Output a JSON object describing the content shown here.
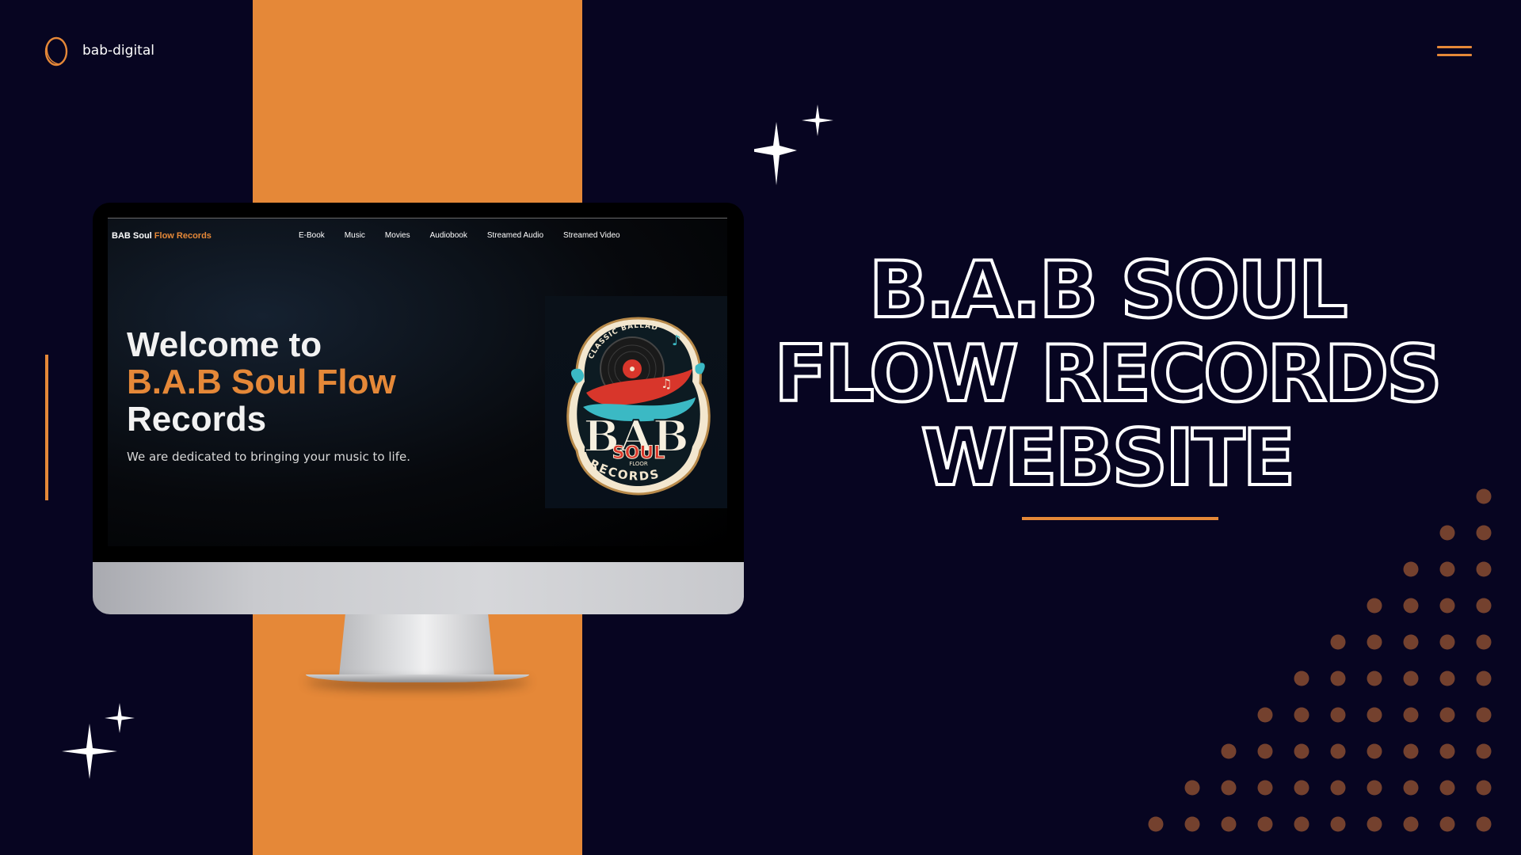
{
  "brand": {
    "name": "bab-digital",
    "logo_icon": "ring-logo-icon"
  },
  "menu": {
    "icon": "hamburger-menu-icon"
  },
  "colors": {
    "background": "#070521",
    "accent": "#e58838",
    "text": "#ffffff"
  },
  "monitor": {
    "site": {
      "logo_white": "BAB Soul",
      "logo_orange": "Flow Records",
      "nav": [
        "E-Book",
        "Music",
        "Movies",
        "Audiobook",
        "Streamed Audio",
        "Streamed Video"
      ],
      "hero": {
        "line1": "Welcome to",
        "line2": "B.A.B Soul Flow",
        "line3": "Records",
        "subtitle": "We are dedicated to bringing your music to life."
      },
      "emblem": {
        "top_text": "CLASSIC BALLAD",
        "main": "BAB",
        "sub": "SOUL",
        "small": "FLOOR",
        "bottom": "RECORDS"
      }
    }
  },
  "headline": {
    "line1": "B.A.B SOUL",
    "line2": "FLOW RECORDS",
    "line3": "WEBSITE"
  }
}
